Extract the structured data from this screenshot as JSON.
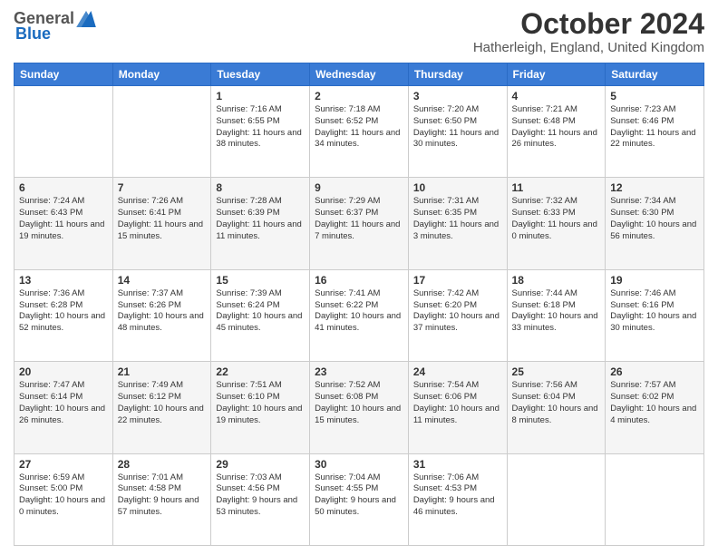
{
  "logo": {
    "general": "General",
    "blue": "Blue"
  },
  "title": "October 2024",
  "location": "Hatherleigh, England, United Kingdom",
  "days_of_week": [
    "Sunday",
    "Monday",
    "Tuesday",
    "Wednesday",
    "Thursday",
    "Friday",
    "Saturday"
  ],
  "weeks": [
    [
      {
        "day": "",
        "sunrise": "",
        "sunset": "",
        "daylight": ""
      },
      {
        "day": "",
        "sunrise": "",
        "sunset": "",
        "daylight": ""
      },
      {
        "day": "1",
        "sunrise": "Sunrise: 7:16 AM",
        "sunset": "Sunset: 6:55 PM",
        "daylight": "Daylight: 11 hours and 38 minutes."
      },
      {
        "day": "2",
        "sunrise": "Sunrise: 7:18 AM",
        "sunset": "Sunset: 6:52 PM",
        "daylight": "Daylight: 11 hours and 34 minutes."
      },
      {
        "day": "3",
        "sunrise": "Sunrise: 7:20 AM",
        "sunset": "Sunset: 6:50 PM",
        "daylight": "Daylight: 11 hours and 30 minutes."
      },
      {
        "day": "4",
        "sunrise": "Sunrise: 7:21 AM",
        "sunset": "Sunset: 6:48 PM",
        "daylight": "Daylight: 11 hours and 26 minutes."
      },
      {
        "day": "5",
        "sunrise": "Sunrise: 7:23 AM",
        "sunset": "Sunset: 6:46 PM",
        "daylight": "Daylight: 11 hours and 22 minutes."
      }
    ],
    [
      {
        "day": "6",
        "sunrise": "Sunrise: 7:24 AM",
        "sunset": "Sunset: 6:43 PM",
        "daylight": "Daylight: 11 hours and 19 minutes."
      },
      {
        "day": "7",
        "sunrise": "Sunrise: 7:26 AM",
        "sunset": "Sunset: 6:41 PM",
        "daylight": "Daylight: 11 hours and 15 minutes."
      },
      {
        "day": "8",
        "sunrise": "Sunrise: 7:28 AM",
        "sunset": "Sunset: 6:39 PM",
        "daylight": "Daylight: 11 hours and 11 minutes."
      },
      {
        "day": "9",
        "sunrise": "Sunrise: 7:29 AM",
        "sunset": "Sunset: 6:37 PM",
        "daylight": "Daylight: 11 hours and 7 minutes."
      },
      {
        "day": "10",
        "sunrise": "Sunrise: 7:31 AM",
        "sunset": "Sunset: 6:35 PM",
        "daylight": "Daylight: 11 hours and 3 minutes."
      },
      {
        "day": "11",
        "sunrise": "Sunrise: 7:32 AM",
        "sunset": "Sunset: 6:33 PM",
        "daylight": "Daylight: 11 hours and 0 minutes."
      },
      {
        "day": "12",
        "sunrise": "Sunrise: 7:34 AM",
        "sunset": "Sunset: 6:30 PM",
        "daylight": "Daylight: 10 hours and 56 minutes."
      }
    ],
    [
      {
        "day": "13",
        "sunrise": "Sunrise: 7:36 AM",
        "sunset": "Sunset: 6:28 PM",
        "daylight": "Daylight: 10 hours and 52 minutes."
      },
      {
        "day": "14",
        "sunrise": "Sunrise: 7:37 AM",
        "sunset": "Sunset: 6:26 PM",
        "daylight": "Daylight: 10 hours and 48 minutes."
      },
      {
        "day": "15",
        "sunrise": "Sunrise: 7:39 AM",
        "sunset": "Sunset: 6:24 PM",
        "daylight": "Daylight: 10 hours and 45 minutes."
      },
      {
        "day": "16",
        "sunrise": "Sunrise: 7:41 AM",
        "sunset": "Sunset: 6:22 PM",
        "daylight": "Daylight: 10 hours and 41 minutes."
      },
      {
        "day": "17",
        "sunrise": "Sunrise: 7:42 AM",
        "sunset": "Sunset: 6:20 PM",
        "daylight": "Daylight: 10 hours and 37 minutes."
      },
      {
        "day": "18",
        "sunrise": "Sunrise: 7:44 AM",
        "sunset": "Sunset: 6:18 PM",
        "daylight": "Daylight: 10 hours and 33 minutes."
      },
      {
        "day": "19",
        "sunrise": "Sunrise: 7:46 AM",
        "sunset": "Sunset: 6:16 PM",
        "daylight": "Daylight: 10 hours and 30 minutes."
      }
    ],
    [
      {
        "day": "20",
        "sunrise": "Sunrise: 7:47 AM",
        "sunset": "Sunset: 6:14 PM",
        "daylight": "Daylight: 10 hours and 26 minutes."
      },
      {
        "day": "21",
        "sunrise": "Sunrise: 7:49 AM",
        "sunset": "Sunset: 6:12 PM",
        "daylight": "Daylight: 10 hours and 22 minutes."
      },
      {
        "day": "22",
        "sunrise": "Sunrise: 7:51 AM",
        "sunset": "Sunset: 6:10 PM",
        "daylight": "Daylight: 10 hours and 19 minutes."
      },
      {
        "day": "23",
        "sunrise": "Sunrise: 7:52 AM",
        "sunset": "Sunset: 6:08 PM",
        "daylight": "Daylight: 10 hours and 15 minutes."
      },
      {
        "day": "24",
        "sunrise": "Sunrise: 7:54 AM",
        "sunset": "Sunset: 6:06 PM",
        "daylight": "Daylight: 10 hours and 11 minutes."
      },
      {
        "day": "25",
        "sunrise": "Sunrise: 7:56 AM",
        "sunset": "Sunset: 6:04 PM",
        "daylight": "Daylight: 10 hours and 8 minutes."
      },
      {
        "day": "26",
        "sunrise": "Sunrise: 7:57 AM",
        "sunset": "Sunset: 6:02 PM",
        "daylight": "Daylight: 10 hours and 4 minutes."
      }
    ],
    [
      {
        "day": "27",
        "sunrise": "Sunrise: 6:59 AM",
        "sunset": "Sunset: 5:00 PM",
        "daylight": "Daylight: 10 hours and 0 minutes."
      },
      {
        "day": "28",
        "sunrise": "Sunrise: 7:01 AM",
        "sunset": "Sunset: 4:58 PM",
        "daylight": "Daylight: 9 hours and 57 minutes."
      },
      {
        "day": "29",
        "sunrise": "Sunrise: 7:03 AM",
        "sunset": "Sunset: 4:56 PM",
        "daylight": "Daylight: 9 hours and 53 minutes."
      },
      {
        "day": "30",
        "sunrise": "Sunrise: 7:04 AM",
        "sunset": "Sunset: 4:55 PM",
        "daylight": "Daylight: 9 hours and 50 minutes."
      },
      {
        "day": "31",
        "sunrise": "Sunrise: 7:06 AM",
        "sunset": "Sunset: 4:53 PM",
        "daylight": "Daylight: 9 hours and 46 minutes."
      },
      {
        "day": "",
        "sunrise": "",
        "sunset": "",
        "daylight": ""
      },
      {
        "day": "",
        "sunrise": "",
        "sunset": "",
        "daylight": ""
      }
    ]
  ]
}
